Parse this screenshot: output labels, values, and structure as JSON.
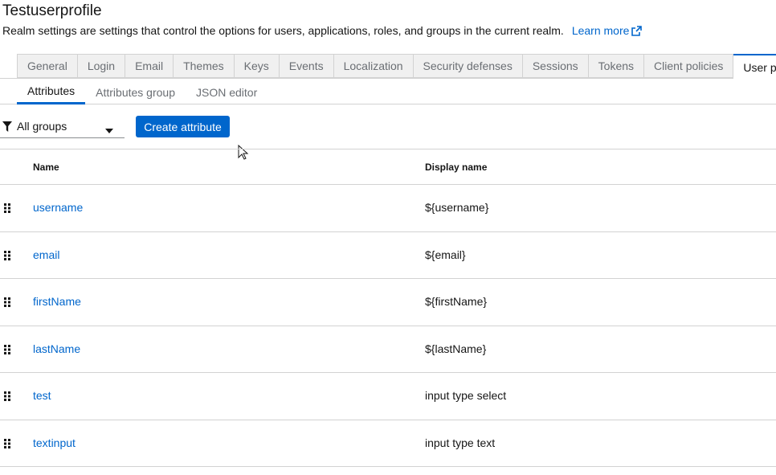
{
  "header": {
    "title": "Testuserprofile",
    "description": "Realm settings are settings that control the options for users, applications, roles, and groups in the current realm.",
    "learn_more": "Learn more"
  },
  "tabs": [
    {
      "label": "General"
    },
    {
      "label": "Login"
    },
    {
      "label": "Email"
    },
    {
      "label": "Themes"
    },
    {
      "label": "Keys"
    },
    {
      "label": "Events"
    },
    {
      "label": "Localization"
    },
    {
      "label": "Security defenses"
    },
    {
      "label": "Sessions"
    },
    {
      "label": "Tokens"
    },
    {
      "label": "Client policies"
    },
    {
      "label": "User profile",
      "active": true
    }
  ],
  "subtabs": [
    {
      "label": "Attributes",
      "active": true
    },
    {
      "label": "Attributes group"
    },
    {
      "label": "JSON editor"
    }
  ],
  "toolbar": {
    "group_filter": "All groups",
    "create_button": "Create attribute"
  },
  "table": {
    "columns": [
      "Name",
      "Display name"
    ],
    "rows": [
      {
        "name": "username",
        "display": "${username}"
      },
      {
        "name": "email",
        "display": "${email}"
      },
      {
        "name": "firstName",
        "display": "${firstName}"
      },
      {
        "name": "lastName",
        "display": "${lastName}"
      },
      {
        "name": "test",
        "display": "input type select"
      },
      {
        "name": "textinput",
        "display": "input type text"
      }
    ]
  },
  "colors": {
    "accent": "#0066cc",
    "border": "#d2d2d2",
    "tab_bg": "#f0f0f0",
    "muted_text": "#6a6e73"
  },
  "icons": [
    "external-link-icon",
    "filter-icon",
    "caret-down-icon",
    "drag-handle-icon",
    "mouse-cursor-icon"
  ]
}
